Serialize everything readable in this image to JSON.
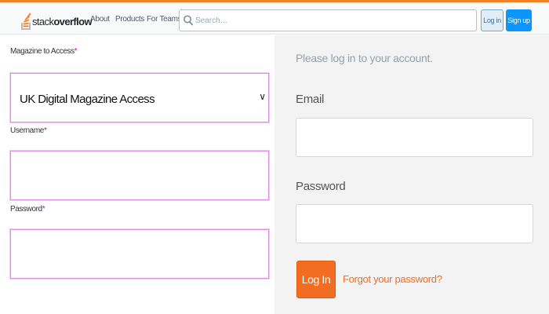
{
  "header": {
    "logo": {
      "prefix": "stack",
      "suffix": "overflow"
    },
    "nav": [
      "About",
      "Products",
      "For Teams"
    ],
    "search": {
      "placeholder": "Search…",
      "value": ""
    },
    "login_label": "Log in",
    "signup_label": "Sign up"
  },
  "left_form": {
    "magazine": {
      "label": "Magazine to Access",
      "required_mark": "*",
      "selected": "UK Digital Magazine Access"
    },
    "username": {
      "label": "Username",
      "required_mark": "*",
      "value": ""
    },
    "password": {
      "label": "Password",
      "required_mark": "*",
      "value": ""
    }
  },
  "right_form": {
    "prompt": "Please log in to your account.",
    "email": {
      "label": "Email",
      "value": ""
    },
    "password": {
      "label": "Password",
      "value": ""
    },
    "login_button": "Log In",
    "forgot_link": "Forgot your password?"
  },
  "colors": {
    "accent_orange": "#f48024",
    "login_orange": "#f26d21",
    "signup_blue": "#0a95ff",
    "field_border_pink": "#e28ce8"
  },
  "icons": {
    "logo": "stack-overflow-logo-icon",
    "search": "search-icon",
    "select": "chevron-down-icon"
  }
}
